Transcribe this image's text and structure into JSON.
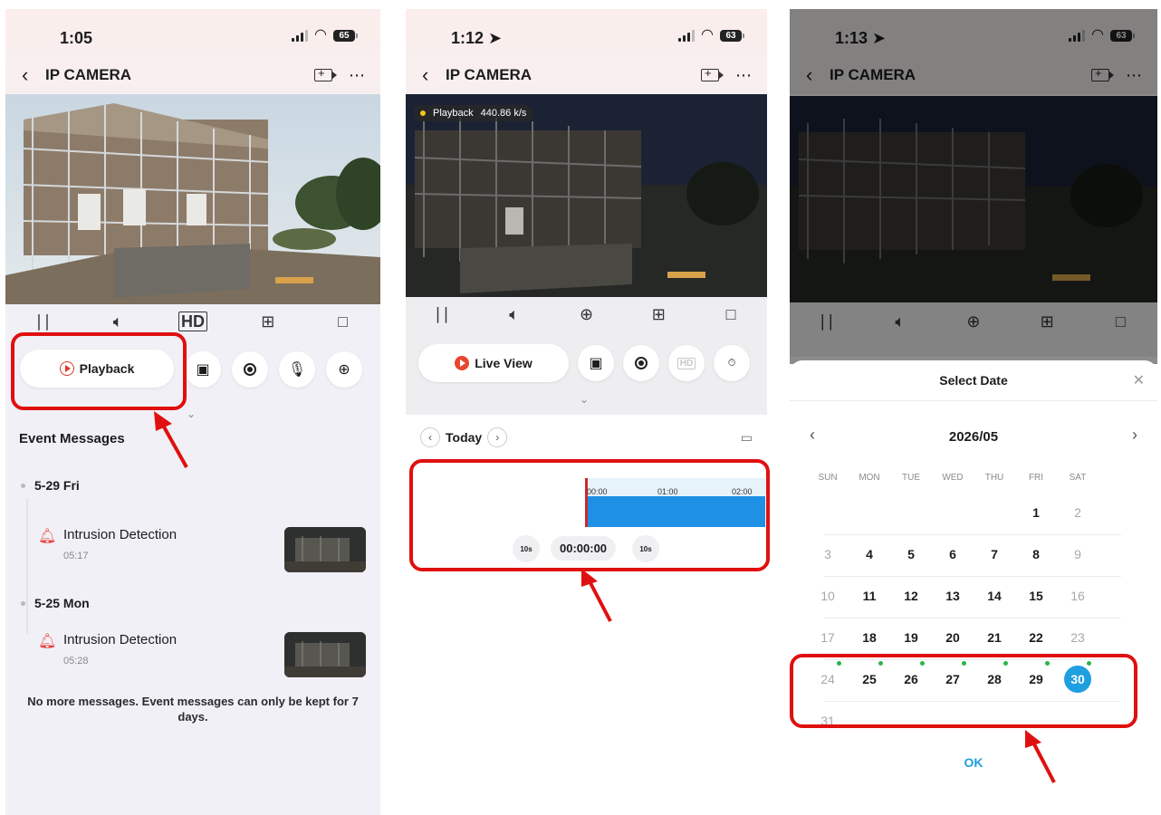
{
  "colors": {
    "accent_blue": "#1e9fe0",
    "highlight_red": "#e01010",
    "timeline_blue": "#1e90e6",
    "event_bell": "#e8453c",
    "dot_green": "#2bb34a"
  },
  "screen1": {
    "time": "1:05",
    "battery": "65",
    "title": "IP CAMERA",
    "controls": [
      "pause-icon",
      "speaker-icon",
      "hd-icon",
      "grid-icon",
      "screen-rotate-icon"
    ],
    "hd_label": "HD",
    "playback_label": "Playback",
    "section_title": "Event Messages",
    "days": [
      {
        "label": "5-29 Fri",
        "events": [
          {
            "title": "Intrusion Detection",
            "time": "05:17"
          }
        ]
      },
      {
        "label": "5-25 Mon",
        "events": [
          {
            "title": "Intrusion Detection",
            "time": "05:28"
          }
        ]
      }
    ],
    "footer": "No more messages. Event messages can only be kept for 7 days."
  },
  "screen2": {
    "time": "1:12",
    "battery": "63",
    "title": "IP CAMERA",
    "badge_label": "Playback",
    "badge_rate": "440.86 k/s",
    "hd_label": "HD",
    "live_view_label": "Live View",
    "date_label": "Today",
    "tick_labels": [
      "00:00",
      "01:00",
      "02:00"
    ],
    "timecode": "00:00:00",
    "skip_back": "10s",
    "skip_fwd": "10s"
  },
  "screen3": {
    "time": "1:13",
    "battery": "63",
    "title": "IP CAMERA",
    "sheet_title": "Select Date",
    "month_label": "2026/05",
    "weekdays": [
      "SUN",
      "MON",
      "TUE",
      "WED",
      "THU",
      "FRI",
      "SAT"
    ],
    "weeks": [
      [
        "",
        "",
        "",
        "",
        "",
        "1",
        "2"
      ],
      [
        "3",
        "4",
        "5",
        "6",
        "7",
        "8",
        "9"
      ],
      [
        "10",
        "11",
        "12",
        "13",
        "14",
        "15",
        "16"
      ],
      [
        "17",
        "18",
        "19",
        "20",
        "21",
        "22",
        "23"
      ],
      [
        "24",
        "25",
        "26",
        "27",
        "28",
        "29",
        "30"
      ],
      [
        "31",
        "",
        "",
        "",
        "",
        "",
        ""
      ]
    ],
    "selected_day": "30",
    "days_with_recordings": [
      "24",
      "25",
      "26",
      "27",
      "28",
      "29",
      "30"
    ],
    "ok_label": "OK"
  }
}
